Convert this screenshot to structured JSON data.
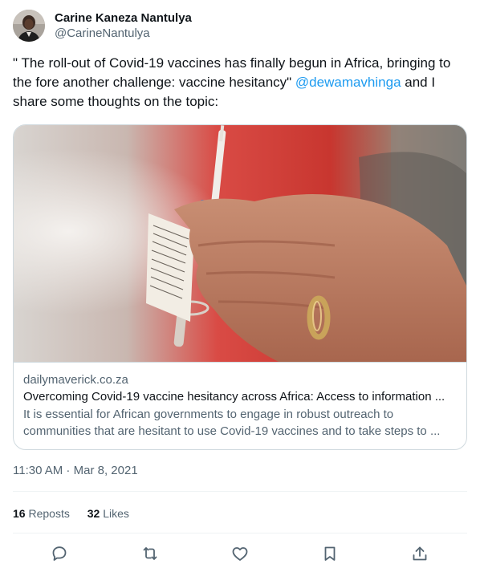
{
  "author": {
    "name": "Carine Kaneza Nantulya",
    "handle": "@CarineNantulya"
  },
  "tweet": {
    "text_before_mention": "\" The roll-out of Covid-19 vaccines has finally begun in Africa, bringing to the fore another challenge: vaccine hesitancy\" ",
    "mention": "@dewamavhinga",
    "text_after_mention": " and I share some thoughts on the topic:"
  },
  "card": {
    "domain": "dailymaverick.co.za",
    "title": "Overcoming Covid-19 vaccine hesitancy across Africa: Access to information ...",
    "description": "It is essential for African governments to engage in robust outreach to communities that are hesitant to use Covid-19 vaccines and to take steps to ..."
  },
  "timestamp": {
    "time": "11:30 AM",
    "separator": " · ",
    "date": "Mar 8, 2021"
  },
  "stats": {
    "reposts_count": "16",
    "reposts_label": "Reposts",
    "likes_count": "32",
    "likes_label": "Likes"
  },
  "actions": {
    "icons": [
      "reply-icon",
      "repost-icon",
      "like-icon",
      "bookmark-icon",
      "share-icon"
    ]
  },
  "colors": {
    "link": "#1d9bf0",
    "text_primary": "#0f1419",
    "text_secondary": "#536471",
    "border": "#cfd9de"
  }
}
